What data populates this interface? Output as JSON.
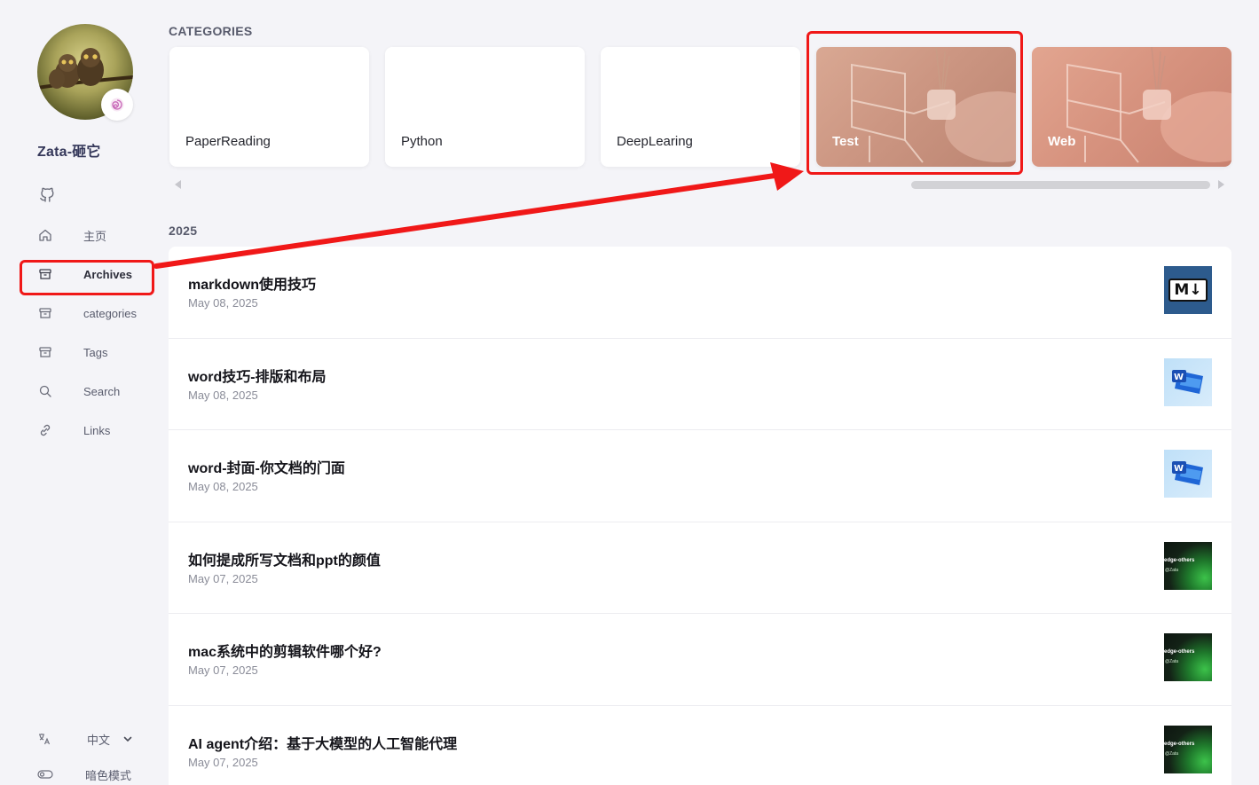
{
  "sidebar": {
    "site_name": "Zata-砸它",
    "nav": [
      {
        "label": "主页",
        "icon": "home-icon"
      },
      {
        "label": "Archives",
        "icon": "archive-icon",
        "active": true
      },
      {
        "label": "categories",
        "icon": "archive-icon"
      },
      {
        "label": "Tags",
        "icon": "archive-icon"
      },
      {
        "label": "Search",
        "icon": "search-icon"
      },
      {
        "label": "Links",
        "icon": "link-icon"
      }
    ],
    "language": "中文",
    "dark_mode_label": "暗色模式"
  },
  "categories": {
    "title": "CATEGORIES",
    "items": [
      {
        "label": "PaperReading"
      },
      {
        "label": "Python"
      },
      {
        "label": "DeepLearing"
      },
      {
        "label": "Test"
      },
      {
        "label": "Web"
      }
    ]
  },
  "archive": {
    "year": "2025",
    "posts": [
      {
        "title": "markdown使用技巧",
        "date": "May 08, 2025",
        "thumb": "markdown"
      },
      {
        "title": "word技巧-排版和布局",
        "date": "May 08, 2025",
        "thumb": "word"
      },
      {
        "title": "word-封面-你文档的门面",
        "date": "May 08, 2025",
        "thumb": "word"
      },
      {
        "title": "如何提成所写文档和ppt的颜值",
        "date": "May 07, 2025",
        "thumb": "edge"
      },
      {
        "title": "mac系统中的剪辑软件哪个好?",
        "date": "May 07, 2025",
        "thumb": "edge"
      },
      {
        "title": "AI agent介绍：基于大模型的人工智能代理",
        "date": "May 07, 2025",
        "thumb": "edge"
      }
    ],
    "thumb_text": {
      "markdown": "M↓",
      "edge_line1": "edge-others",
      "edge_line2": "@Zata"
    }
  },
  "colors": {
    "annotation": "#f01818",
    "accent": "#35385a"
  }
}
